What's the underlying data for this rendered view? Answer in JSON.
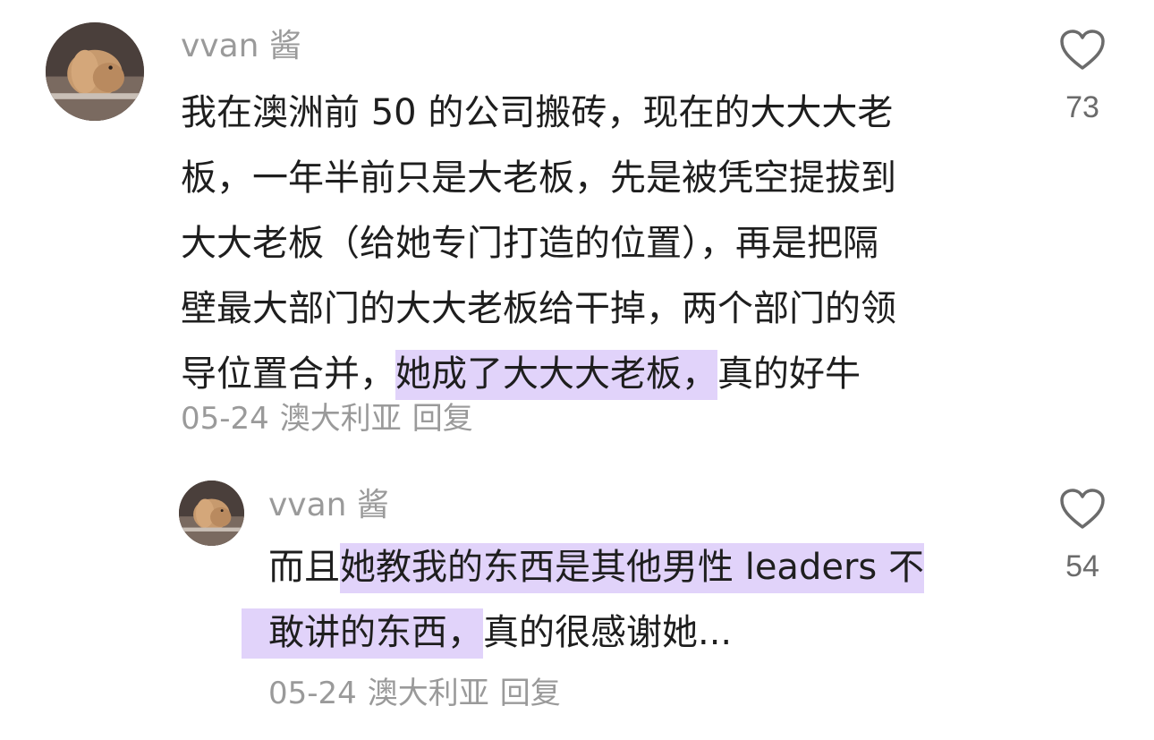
{
  "comments": [
    {
      "username": "vvan 酱",
      "lines": [
        "我在澳洲前 50 的公司搬砖，现在的大大大老",
        "板，一年半前只是大老板，先是被凭空提拔到",
        "大大老板（给她专门打造的位置），再是把隔",
        "壁最大部门的大大老板给干掉，两个部门的领"
      ],
      "last_line_start": "导位置合并，",
      "last_line_highlight": "她成了大大大老板，",
      "last_line_end": "真的好牛",
      "date": "05-24",
      "location": "澳大利亚",
      "reply_label": "回复",
      "like_count": "73"
    },
    {
      "username": "vvan 酱",
      "line1_start": "而且",
      "line1_highlight": "她教我的东西是其他男性 leaders 不",
      "line2_highlight": "敢讲的东西，",
      "line2_end": "真的很感谢她...",
      "date": "05-24",
      "location": "澳大利亚",
      "reply_label": "回复",
      "like_count": "54"
    }
  ],
  "colors": {
    "highlight": "#e1d3fa",
    "text": "#1e1e1e",
    "muted": "#9a9a9a"
  },
  "icons": {
    "avatar": "rabbit-avatar-icon",
    "like": "heart-outline-icon"
  }
}
